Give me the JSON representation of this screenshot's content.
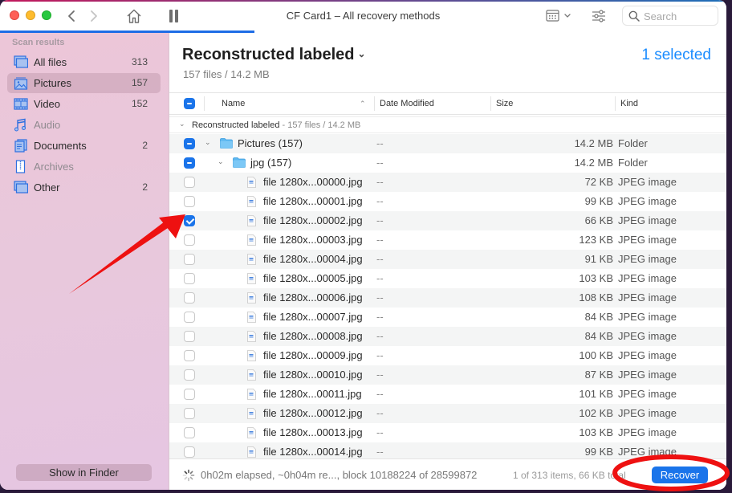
{
  "window": {
    "title": "CF Card1 – All recovery methods",
    "scan_progress_fraction": 0.35
  },
  "toolbar": {
    "back_icon": "chevron-left-icon",
    "forward_icon": "chevron-right-icon",
    "home_icon": "home-icon",
    "pause_icon": "pause-icon",
    "view_icon": "calendar-grid-icon",
    "filter_icon": "sliders-icon",
    "search_placeholder": "Search",
    "search_value": ""
  },
  "sidebar": {
    "header": "Scan results",
    "items": [
      {
        "label": "All files",
        "count": "313",
        "icon": "all-files-icon",
        "active": false,
        "dim": false
      },
      {
        "label": "Pictures",
        "count": "157",
        "icon": "pictures-icon",
        "active": true,
        "dim": false
      },
      {
        "label": "Video",
        "count": "152",
        "icon": "video-icon",
        "active": false,
        "dim": false
      },
      {
        "label": "Audio",
        "count": "",
        "icon": "audio-icon",
        "active": false,
        "dim": true
      },
      {
        "label": "Documents",
        "count": "2",
        "icon": "documents-icon",
        "active": false,
        "dim": false
      },
      {
        "label": "Archives",
        "count": "",
        "icon": "archives-icon",
        "active": false,
        "dim": true
      },
      {
        "label": "Other",
        "count": "2",
        "icon": "other-icon",
        "active": false,
        "dim": false
      }
    ],
    "show_in_finder": "Show in Finder"
  },
  "main": {
    "heading": "Reconstructed labeled",
    "subheading": "157 files / 14.2 MB",
    "selected": "1 selected",
    "columns": {
      "name": "Name",
      "date": "Date Modified",
      "size": "Size",
      "kind": "Kind"
    },
    "group": {
      "title": "Reconstructed labeled",
      "meta": " - 157 files / 14.2 MB"
    },
    "rows": [
      {
        "type": "folder",
        "level": 0,
        "name": "Pictures (157)",
        "date": "--",
        "size": "14.2 MB",
        "kind": "Folder",
        "check": "mixed"
      },
      {
        "type": "folder",
        "level": 1,
        "name": "jpg (157)",
        "date": "--",
        "size": "14.2 MB",
        "kind": "Folder",
        "check": "mixed"
      },
      {
        "type": "file",
        "name": "file 1280x...00000.jpg",
        "date": "--",
        "size": "72 KB",
        "kind": "JPEG image",
        "check": "none"
      },
      {
        "type": "file",
        "name": "file 1280x...00001.jpg",
        "date": "--",
        "size": "99 KB",
        "kind": "JPEG image",
        "check": "none"
      },
      {
        "type": "file",
        "name": "file 1280x...00002.jpg",
        "date": "--",
        "size": "66 KB",
        "kind": "JPEG image",
        "check": "checked"
      },
      {
        "type": "file",
        "name": "file 1280x...00003.jpg",
        "date": "--",
        "size": "123 KB",
        "kind": "JPEG image",
        "check": "none"
      },
      {
        "type": "file",
        "name": "file 1280x...00004.jpg",
        "date": "--",
        "size": "91 KB",
        "kind": "JPEG image",
        "check": "none"
      },
      {
        "type": "file",
        "name": "file 1280x...00005.jpg",
        "date": "--",
        "size": "103 KB",
        "kind": "JPEG image",
        "check": "none"
      },
      {
        "type": "file",
        "name": "file 1280x...00006.jpg",
        "date": "--",
        "size": "108 KB",
        "kind": "JPEG image",
        "check": "none"
      },
      {
        "type": "file",
        "name": "file 1280x...00007.jpg",
        "date": "--",
        "size": "84 KB",
        "kind": "JPEG image",
        "check": "none"
      },
      {
        "type": "file",
        "name": "file 1280x...00008.jpg",
        "date": "--",
        "size": "84 KB",
        "kind": "JPEG image",
        "check": "none"
      },
      {
        "type": "file",
        "name": "file 1280x...00009.jpg",
        "date": "--",
        "size": "100 KB",
        "kind": "JPEG image",
        "check": "none"
      },
      {
        "type": "file",
        "name": "file 1280x...00010.jpg",
        "date": "--",
        "size": "87 KB",
        "kind": "JPEG image",
        "check": "none"
      },
      {
        "type": "file",
        "name": "file 1280x...00011.jpg",
        "date": "--",
        "size": "101 KB",
        "kind": "JPEG image",
        "check": "none"
      },
      {
        "type": "file",
        "name": "file 1280x...00012.jpg",
        "date": "--",
        "size": "102 KB",
        "kind": "JPEG image",
        "check": "none"
      },
      {
        "type": "file",
        "name": "file 1280x...00013.jpg",
        "date": "--",
        "size": "103 KB",
        "kind": "JPEG image",
        "check": "none"
      },
      {
        "type": "file",
        "name": "file 1280x...00014.jpg",
        "date": "--",
        "size": "99 KB",
        "kind": "JPEG image",
        "check": "none"
      }
    ]
  },
  "status": {
    "progress_text": "0h02m elapsed, ~0h04m re..., block 10188224 of 28599872",
    "items_text": "1 of 313 items, 66 KB total",
    "recover": "Recover"
  },
  "annotations": {
    "arrow_color": "#ee1111",
    "ellipse_color": "#ee1111"
  }
}
